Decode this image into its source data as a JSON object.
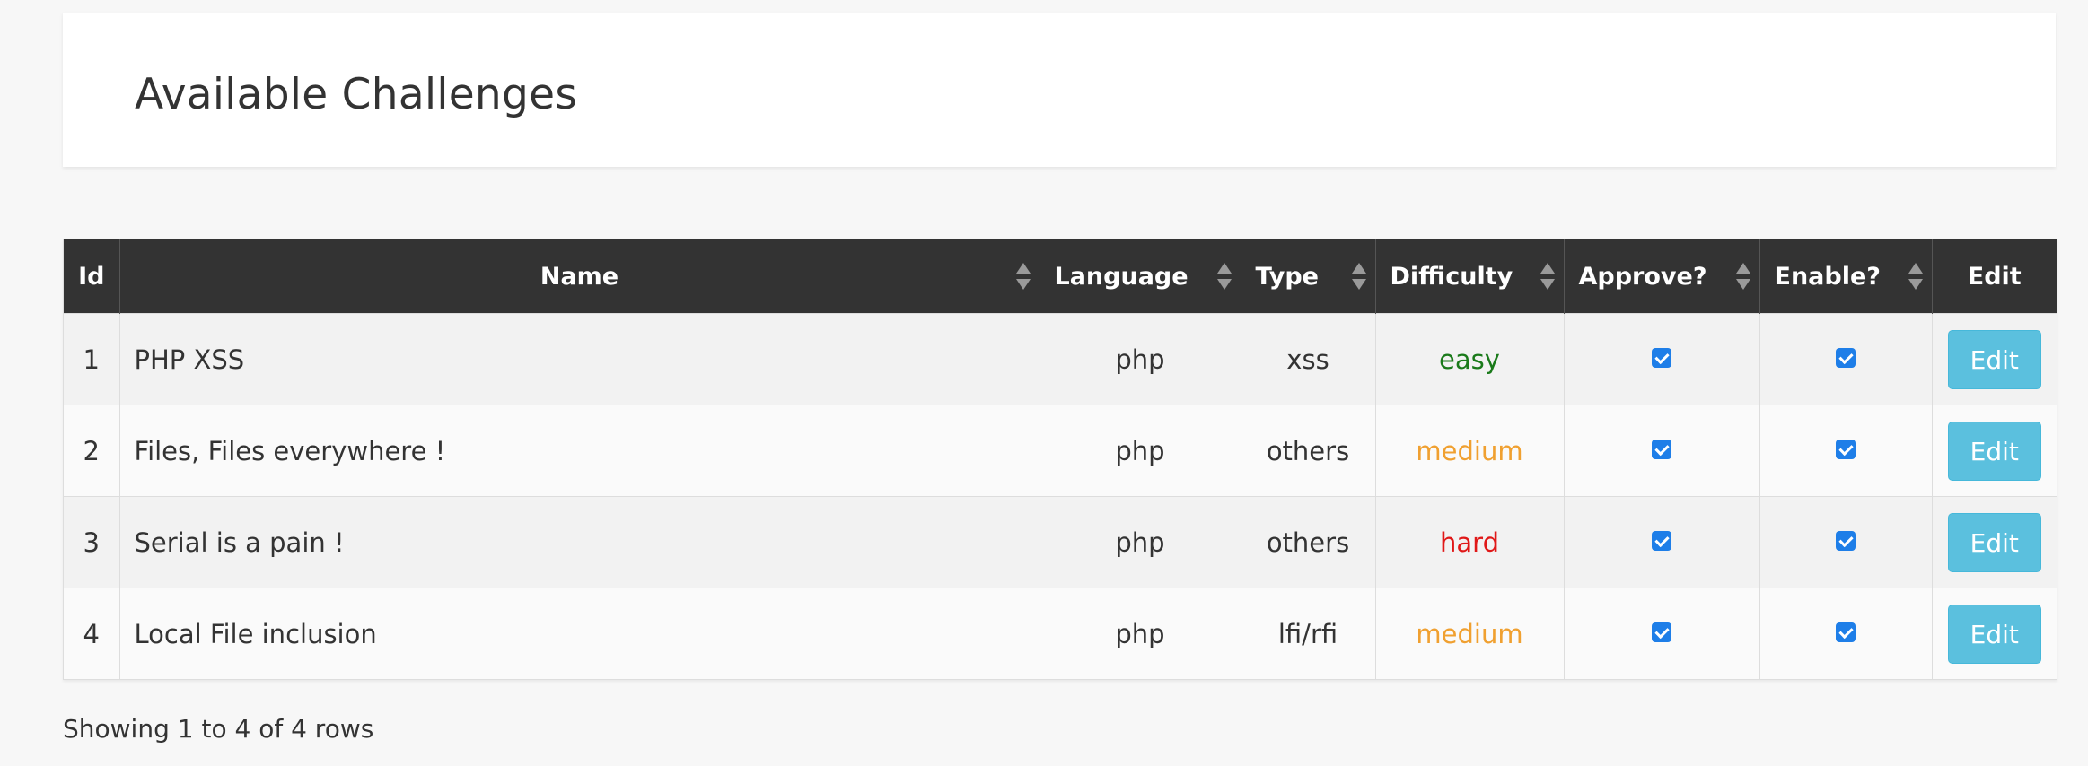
{
  "header": {
    "title": "Available Challenges"
  },
  "table": {
    "columns": [
      {
        "label": "Id",
        "sortable": false
      },
      {
        "label": "Name",
        "sortable": true
      },
      {
        "label": "Language",
        "sortable": true
      },
      {
        "label": "Type",
        "sortable": true
      },
      {
        "label": "Difficulty",
        "sortable": true
      },
      {
        "label": "Approve?",
        "sortable": true
      },
      {
        "label": "Enable?",
        "sortable": true
      },
      {
        "label": "Edit",
        "sortable": false
      }
    ],
    "rows": [
      {
        "id": "1",
        "name": "PHP XSS",
        "language": "php",
        "type": "xss",
        "difficulty": "easy",
        "approved": true,
        "enabled": true,
        "edit_label": "Edit"
      },
      {
        "id": "2",
        "name": "Files, Files everywhere !",
        "language": "php",
        "type": "others",
        "difficulty": "medium",
        "approved": true,
        "enabled": true,
        "edit_label": "Edit"
      },
      {
        "id": "3",
        "name": "Serial is a pain !",
        "language": "php",
        "type": "others",
        "difficulty": "hard",
        "approved": true,
        "enabled": true,
        "edit_label": "Edit"
      },
      {
        "id": "4",
        "name": "Local File inclusion",
        "language": "php",
        "type": "lfi/rfi",
        "difficulty": "medium",
        "approved": true,
        "enabled": true,
        "edit_label": "Edit"
      }
    ]
  },
  "footer": {
    "pagination_info": "Showing 1 to 4 of 4 rows"
  },
  "colors": {
    "header_bg": "#333333",
    "easy": "#1a7a1a",
    "medium": "#f0a030",
    "hard": "#e01818",
    "edit_button": "#5bc0de",
    "checkbox": "#1e7ee8"
  },
  "icons": {
    "sort": "sort-arrows-icon",
    "checkbox": "checkbox-checked-icon"
  }
}
